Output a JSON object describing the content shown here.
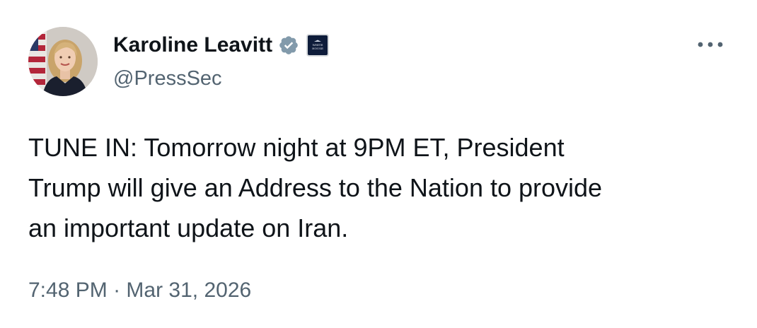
{
  "author": {
    "display_name": "Karoline Leavitt",
    "handle": "@PressSec",
    "verified_badge_icon": "verified-badge-gray",
    "affiliate_badge": {
      "icon": "white-house-logo",
      "text_line1": "WHITE",
      "text_line2": "HOUSE"
    },
    "avatar": "profile-photo"
  },
  "tweet": {
    "text": "TUNE IN: Tomorrow night at 9PM ET, President\nTrump will give an Address to the Nation to provide\nan important update on Iran.",
    "time": "7:48 PM",
    "separator": "·",
    "date": "Mar 31, 2026"
  },
  "menu": {
    "more_icon": "more-horizontal-icon"
  },
  "colors": {
    "text_primary": "#0f1419",
    "text_secondary": "#536471",
    "verified_gray": "#829aab",
    "background": "#ffffff"
  }
}
